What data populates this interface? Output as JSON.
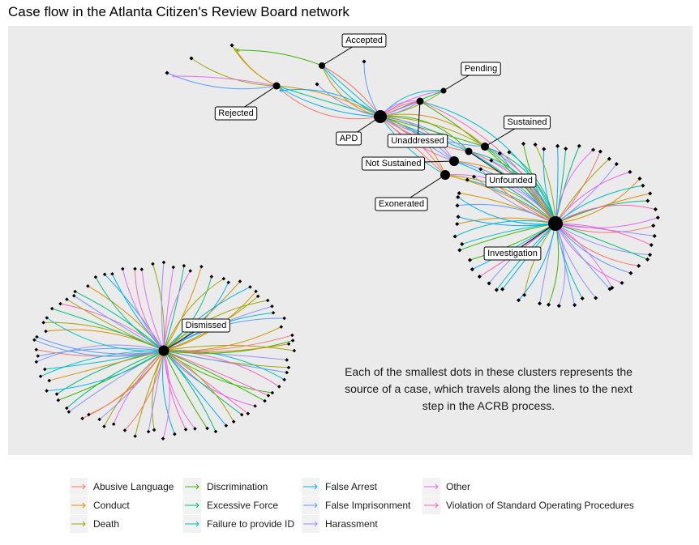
{
  "title": "Case flow in the Atlanta Citizen's Review Board network",
  "annotation": "Each of the smallest dots in these clusters represents the source of a case, which travels along the lines to the next step in the ACRB process.",
  "nodes": [
    "Accepted",
    "Pending",
    "Rejected",
    "APD",
    "Sustained",
    "Unaddressed",
    "Not Sustained",
    "Unfounded",
    "Exonerated",
    "Investigation",
    "Dismissed"
  ],
  "legend": [
    {
      "label": "Abusive Language",
      "color": "#F8766D"
    },
    {
      "label": "Conduct",
      "color": "#D89000"
    },
    {
      "label": "Death",
      "color": "#A3A500"
    },
    {
      "label": "Discrimination",
      "color": "#39B600"
    },
    {
      "label": "Excessive Force",
      "color": "#00BF7D"
    },
    {
      "label": "Failure to provide ID",
      "color": "#00BFC4"
    },
    {
      "label": "False Arrest",
      "color": "#00B0F6"
    },
    {
      "label": "False Imprisonment",
      "color": "#619CFF"
    },
    {
      "label": "Harassment",
      "color": "#9590FF"
    },
    {
      "label": "Other",
      "color": "#E76BF3"
    },
    {
      "label": "Violation of Standard Operating Procedures",
      "color": "#FF62BC"
    }
  ]
}
